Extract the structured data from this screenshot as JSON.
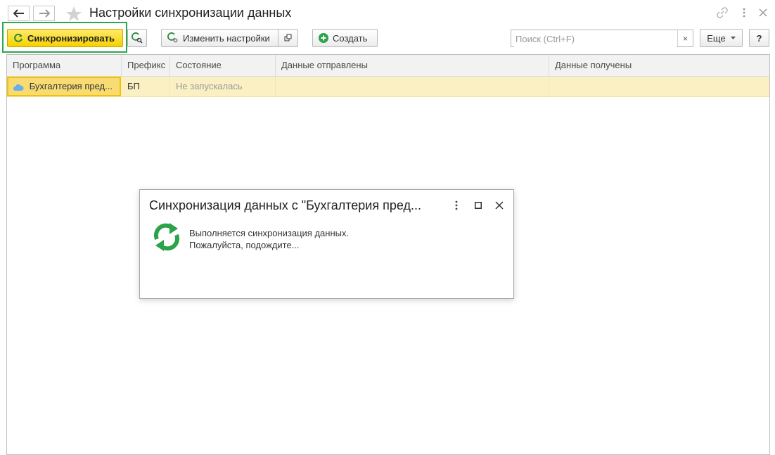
{
  "header": {
    "title": "Настройки синхронизации данных"
  },
  "toolbar": {
    "sync_label": "Синхронизировать",
    "change_settings_label": "Изменить настройки",
    "create_label": "Создать",
    "more_label": "Еще",
    "help_label": "?"
  },
  "search": {
    "placeholder": "Поиск (Ctrl+F)",
    "value": "",
    "clear_label": "×"
  },
  "table": {
    "columns": [
      "Программа",
      "Префикс",
      "Состояние",
      "Данные отправлены",
      "Данные получены"
    ],
    "rows": [
      {
        "program": "Бухгалтерия пред...",
        "prefix": "БП",
        "state": "Не запускалась",
        "sent": "",
        "received": ""
      }
    ]
  },
  "modal": {
    "title": "Синхронизация данных с \"Бухгалтерия пред...",
    "line1": "Выполняется синхронизация данных.",
    "line2": "Пожалуйста, подождите..."
  },
  "colors": {
    "accent_yellow": "#f5d100",
    "highlight_green": "#2ca84a",
    "selected_row": "#fbf0c4",
    "sync_icon_green": "#2aa34a"
  },
  "icons": {
    "back": "arrow-left-icon",
    "forward": "arrow-right-icon",
    "favorite": "star-icon",
    "link": "link-icon",
    "menu": "kebab-icon",
    "close": "close-icon",
    "sync": "sync-icon",
    "cloud": "cloud-icon"
  }
}
